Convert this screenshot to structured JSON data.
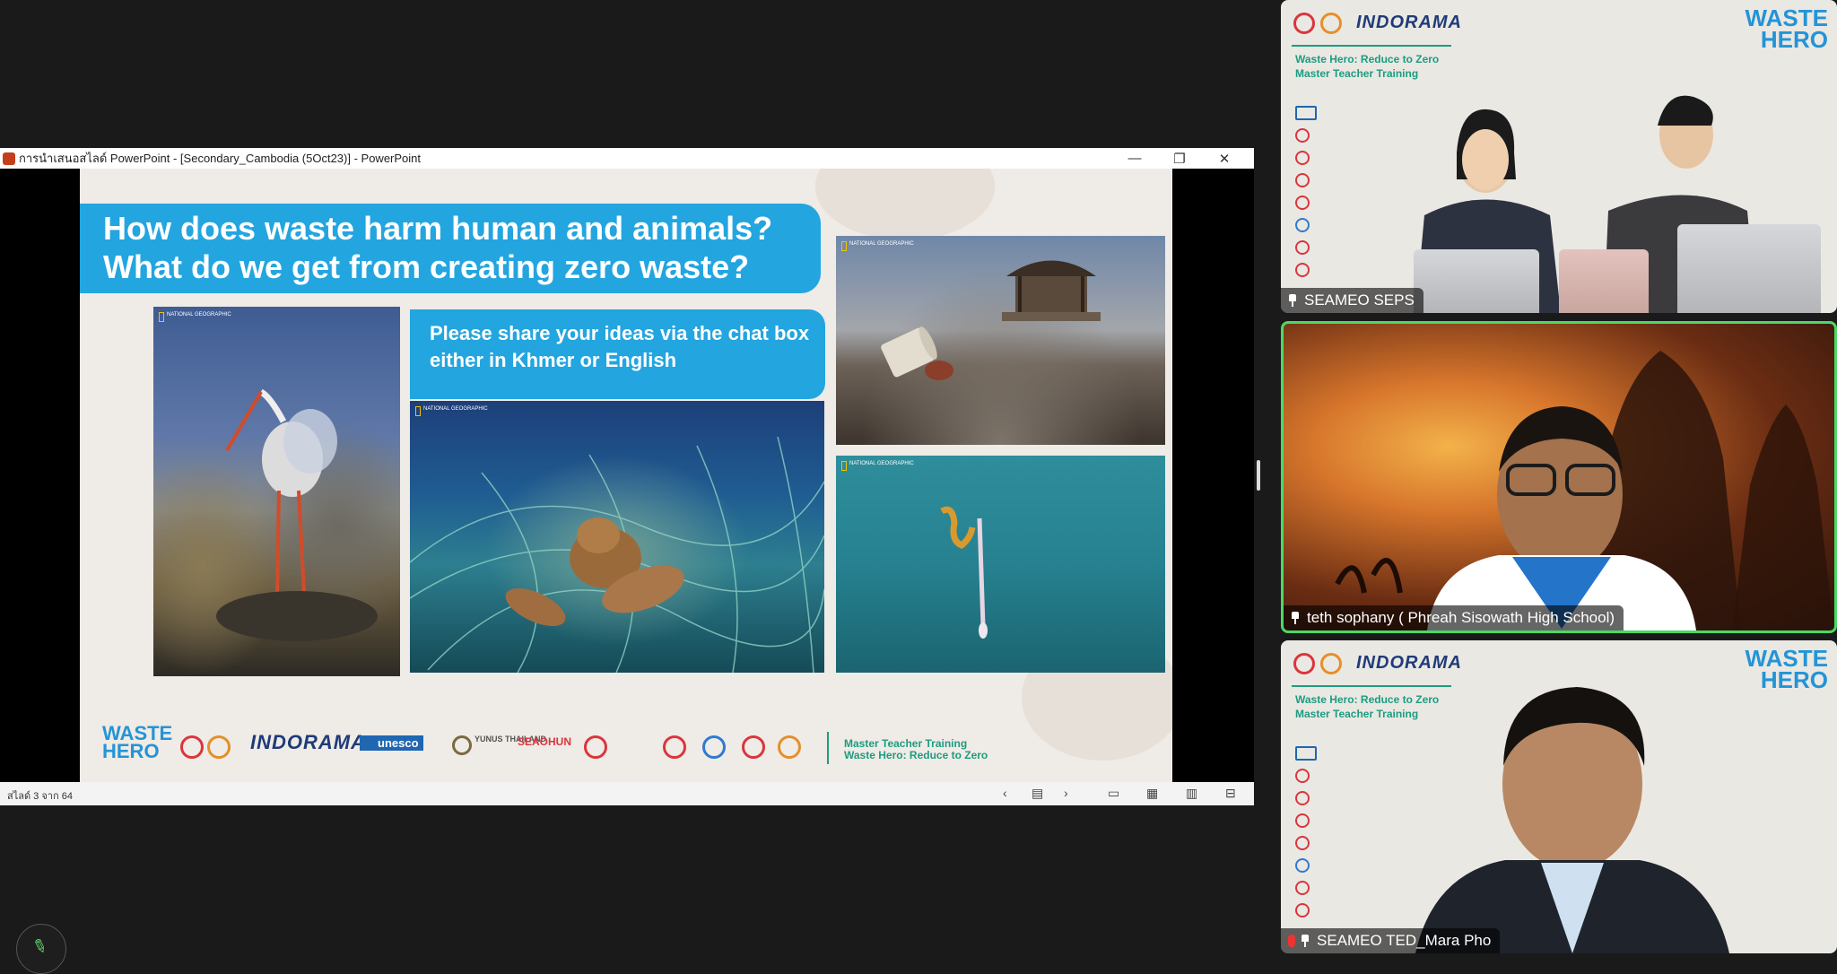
{
  "ppt": {
    "title": "การนำเสนอสไลด์ PowerPoint - [Secondary_Cambodia (5Oct23)] - PowerPoint",
    "status_slide": "สไลด์ 3 จาก 64",
    "minimize_glyph": "—",
    "restore_glyph": "❐",
    "close_glyph": "✕"
  },
  "slide": {
    "question_line1": "How does waste harm human and animals?",
    "question_line2": "What do we get from creating zero waste?",
    "share_line1": "Please share your ideas via the chat box",
    "share_line2": "either in Khmer or English",
    "ng_badge": "NATIONAL GEOGRAPHIC",
    "waste_hero_line1": "WASTE",
    "waste_hero_line2": "HERO",
    "indorama": "INDORAMA",
    "unesco": "unesco",
    "yunus": "YUNUS THAILAND",
    "seahun": "SEAOHUN",
    "footer_caption_line1": "Master Teacher Training",
    "footer_caption_line2": "Waste Hero: Reduce to Zero"
  },
  "statusbar": {
    "prev_glyph": "‹",
    "next_glyph": "›",
    "notes_glyph": "▤",
    "normal_view_glyph": "▭",
    "sorter_glyph": "▦",
    "reading_glyph": "▥",
    "slideshow_glyph": "⊟"
  },
  "tiles": [
    {
      "label": "SEAMEO SEPS",
      "brand": "INDORAMA",
      "caption_line1": "Waste Hero: Reduce to Zero",
      "caption_line2": "Master Teacher Training",
      "waste_hero_line1": "WASTE",
      "waste_hero_line2": "HERO"
    },
    {
      "label": "teth sophany ( Phreah Sisowath High School)"
    },
    {
      "label": "SEAMEO TED_Mara Pho",
      "brand": "INDORAMA",
      "caption_line1": "Waste Hero: Reduce to Zero",
      "caption_line2": "Master Teacher Training",
      "waste_hero_line1": "WASTE",
      "waste_hero_line2": "HERO"
    }
  ],
  "colors": {
    "slide_blue": "#23a5e0",
    "active_speaker_border": "#4cd964",
    "brand_green": "#1d9c80"
  },
  "icons": {
    "pin": "pin-icon",
    "mic_off": "mic-off-icon",
    "pencil": "pencil-icon"
  },
  "pencil_glyph": "✎"
}
